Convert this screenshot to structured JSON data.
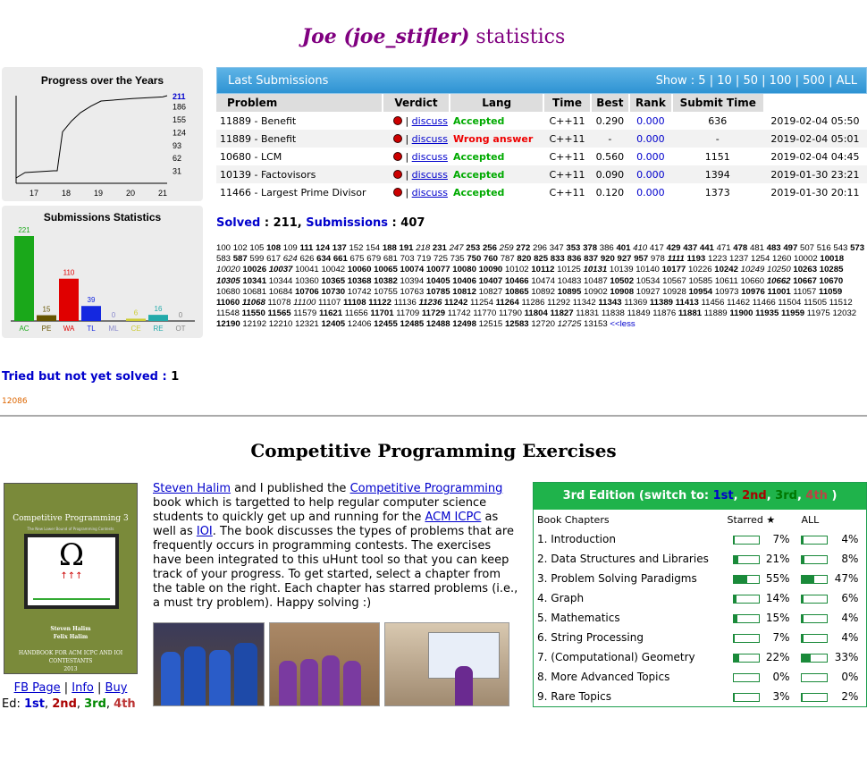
{
  "title": {
    "user": "Joe (joe_stifler)",
    "rest": " statistics"
  },
  "progress": {
    "title": "Progress over the Years",
    "y_ticks": [
      "211",
      "186",
      "155",
      "124",
      "93",
      "62",
      "31"
    ],
    "x_ticks": [
      "17",
      "18",
      "19",
      "20",
      "21"
    ]
  },
  "chart_data": [
    {
      "type": "line",
      "title": "Progress over the Years",
      "x": [
        "17",
        "18",
        "19",
        "20",
        "21"
      ],
      "y_ticks": [
        31,
        62,
        93,
        124,
        155,
        186,
        211
      ],
      "ylim": [
        0,
        211
      ]
    },
    {
      "type": "bar",
      "title": "Submissions Statistics",
      "categories": [
        "AC",
        "PE",
        "WA",
        "TL",
        "ML",
        "CE",
        "RE",
        "OT"
      ],
      "values": [
        221,
        15,
        110,
        39,
        0,
        6,
        16,
        0
      ],
      "colors": [
        "#1aa81a",
        "#665500",
        "#e00000",
        "#1428e0",
        "#8888cc",
        "#cccc33",
        "#22aaaa",
        "#888888"
      ]
    }
  ],
  "subs_stats": {
    "title": "Submissions Statistics"
  },
  "last": {
    "title": "Last Submissions",
    "show_label": "Show :",
    "show_opts": [
      "5",
      "10",
      "50",
      "100",
      "500",
      "ALL"
    ],
    "headers": [
      "Problem",
      "Verdict",
      "Lang",
      "Time",
      "Best",
      "Rank",
      "Submit Time"
    ],
    "discuss": "discuss",
    "rows": [
      {
        "problem": "11889 - Benefit",
        "verdict": "Accepted",
        "ok": true,
        "lang": "C++11",
        "time": "0.290",
        "best": "0.000",
        "rank": "636",
        "submit": "2019-02-04 05:50"
      },
      {
        "problem": "11889 - Benefit",
        "verdict": "Wrong answer",
        "ok": false,
        "lang": "C++11",
        "time": "-",
        "best": "0.000",
        "rank": "-",
        "submit": "2019-02-04 05:01"
      },
      {
        "problem": "10680 - LCM",
        "verdict": "Accepted",
        "ok": true,
        "lang": "C++11",
        "time": "0.560",
        "best": "0.000",
        "rank": "1151",
        "submit": "2019-02-04 04:45"
      },
      {
        "problem": "10139 - Factovisors",
        "verdict": "Accepted",
        "ok": true,
        "lang": "C++11",
        "time": "0.090",
        "best": "0.000",
        "rank": "1394",
        "submit": "2019-01-30 23:21"
      },
      {
        "problem": "11466 - Largest Prime Divisor",
        "verdict": "Accepted",
        "ok": true,
        "lang": "C++11",
        "time": "0.120",
        "best": "0.000",
        "rank": "1373",
        "submit": "2019-01-30 20:11"
      }
    ]
  },
  "solved": {
    "solved_label": "Solved",
    "solved": "211",
    "subs_label": "Submissions",
    "subs": "407"
  },
  "problems": "100 102 105 *108 109 *111 *124 *137 152 154 *188 *191 /218 *231 /247 *253 *256 /259 *272 296 347 *353 *378 386 *401 /410 417 *429 *437 *441 471 *478 481 *483 *497 507 516 543 *573 583 *587 599 617 /624 626 *634 *661 675 679 681 703 719 725 735 *750 *760 787 *820 *825 *833 *836 *837 *920 *927 *957 978 +1111 *1193 1223 1237 1254 1260 10002 *10018 /10020 *10026 +10037 10041 10042 *10060 *10065 *10074 *10077 *10080 *10090 10102 *10112 10125 +10131 10139 10140 *10177 10226 *10242 /10249 /10250 *10263 *10285 +10305 *10341 10344 10360 *10365 *10368 *10382 10394 *10405 *10406 *10407 *10466 10474 10483 10487 *10502 10534 10567 10585 10611 10660 +10662 *10667 *10670 10680 10681 10684 *10706 *10730 10742 10755 10763 *10785 *10812 10827 *10865 10892 *10895 10902 *10908 10927 10928 *10954 10973 *10976 *11001 11057 *11059 *11060 +11068 11078 /11100 11107 *11108 *11122 11136 +11236 *11242 11254 *11264 11286 11292 11342 *11343 11369 *11389 *11413 11456 11462 11466 11504 11505 11512 11548 *11550 *11565 11579 *11621 11656 *11701 11709 *11729 11742 11770 11790 *11804 *11827 11831 11838 11849 11876 *11881 11889 *11900 *11935 *11959 11975 12032 *12190 12192 12210 12321 *12405 12406 *12455 *12485 *12488 *12498 12515 *12583 12720 /12725 13153",
  "less_link": "<<less",
  "tried": {
    "label": "Tried but not yet solved",
    "count": "1",
    "list": "12086"
  },
  "cpe": {
    "title": "Competitive Programming Exercises"
  },
  "book": {
    "title": "Competitive Programming 3",
    "subtitle": "The New Lower Bound of Programming Contests",
    "authors": "Steven Halim\nFelix Halim",
    "footer": "HANDBOOK FOR ACM ICPC AND IOI CONTESTANTS\n2013"
  },
  "book_links": [
    "FB Page",
    "Info",
    "Buy"
  ],
  "ed": {
    "label": "Ed:",
    "e1": "1st",
    "e2": "2nd",
    "e3": "3rd",
    "e4": "4th"
  },
  "desc": {
    "a1": "Steven Halim",
    "t1": " and I published the ",
    "a2": "Competitive Programming",
    "t2": " book which is targetted to help regular computer science students to quickly get up and running for the ",
    "a3": "ACM ICPC",
    "t3": " as well as ",
    "a4": "IOI",
    "t4": ". The book discusses the types of problems that are frequently occurs in programming contests. The exercises have been integrated to this uHunt tool so that you can keep track of your progress. To get started, select a chapter from the table on the right. Each chapter has starred problems (i.e., a must try problem). Happy solving :)"
  },
  "chapters": {
    "head": "3rd Edition (switch to: ",
    "e1": "1st",
    "e2": "2nd",
    "e3": "3rd",
    "e4": "4th",
    "tail": " )",
    "col_book": "Book Chapters",
    "col_star": "Starred ★",
    "col_all": "ALL",
    "rows": [
      {
        "name": "1. Introduction",
        "star": "7%",
        "star_v": 0.07,
        "all": "4%",
        "all_v": 0.04
      },
      {
        "name": "2. Data Structures and Libraries",
        "star": "21%",
        "star_v": 0.21,
        "all": "8%",
        "all_v": 0.08
      },
      {
        "name": "3. Problem Solving Paradigms",
        "star": "55%",
        "star_v": 0.55,
        "all": "47%",
        "all_v": 0.47
      },
      {
        "name": "4. Graph",
        "star": "14%",
        "star_v": 0.14,
        "all": "6%",
        "all_v": 0.06
      },
      {
        "name": "5. Mathematics",
        "star": "15%",
        "star_v": 0.15,
        "all": "4%",
        "all_v": 0.04
      },
      {
        "name": "6. String Processing",
        "star": "7%",
        "star_v": 0.07,
        "all": "4%",
        "all_v": 0.04
      },
      {
        "name": "7. (Computational) Geometry",
        "star": "22%",
        "star_v": 0.22,
        "all": "33%",
        "all_v": 0.33
      },
      {
        "name": "8. More Advanced Topics",
        "star": "0%",
        "star_v": 0,
        "all": "0%",
        "all_v": 0
      },
      {
        "name": "9. Rare Topics",
        "star": "3%",
        "star_v": 0.03,
        "all": "2%",
        "all_v": 0.02
      }
    ]
  }
}
